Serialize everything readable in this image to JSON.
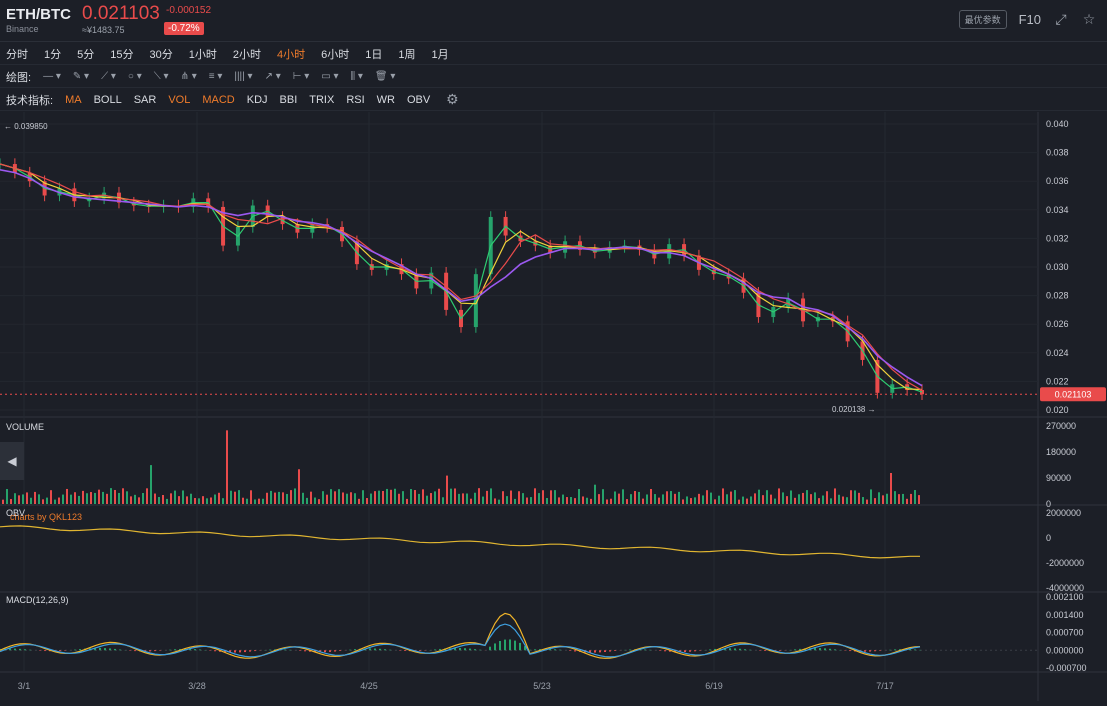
{
  "header": {
    "pair": "ETH/BTC",
    "exchange": "Binance",
    "price": "0.021103",
    "cny": "≈¥1483.75",
    "change": "-0.000152",
    "change_pct": "-0.72%",
    "param_button": "最优参数",
    "f10": "F10",
    "icons": [
      "fullscreen-icon",
      "star-icon"
    ]
  },
  "timeframes": [
    {
      "label": "分时",
      "active": false
    },
    {
      "label": "1分",
      "active": false
    },
    {
      "label": "5分",
      "active": false
    },
    {
      "label": "15分",
      "active": false
    },
    {
      "label": "30分",
      "active": false
    },
    {
      "label": "1小时",
      "active": false
    },
    {
      "label": "2小时",
      "active": false
    },
    {
      "label": "4小时",
      "active": true
    },
    {
      "label": "6小时",
      "active": false
    },
    {
      "label": "1日",
      "active": false
    },
    {
      "label": "1周",
      "active": false
    },
    {
      "label": "1月",
      "active": false
    }
  ],
  "drawing": {
    "label": "绘图:",
    "tools": [
      "—",
      "✎",
      "⟋",
      "○",
      "⟍",
      "⋔",
      "≡",
      "||||",
      "↗",
      "⊢",
      "▭",
      "⫼",
      "🗑"
    ]
  },
  "indicators_bar": {
    "label": "技术指标:",
    "items": [
      {
        "label": "MA",
        "active": true
      },
      {
        "label": "BOLL",
        "active": false
      },
      {
        "label": "SAR",
        "active": false
      },
      {
        "label": "VOL",
        "active": true
      },
      {
        "label": "MACD",
        "active": true
      },
      {
        "label": "KDJ",
        "active": false
      },
      {
        "label": "BBI",
        "active": false
      },
      {
        "label": "TRIX",
        "active": false
      },
      {
        "label": "RSI",
        "active": false
      },
      {
        "label": "WR",
        "active": false
      },
      {
        "label": "OBV",
        "active": false
      }
    ]
  },
  "watermark": "charts by QKL123",
  "colors": {
    "up": "#26a36b",
    "down": "#e94b4b",
    "ma_long": "#9b59f0",
    "ma_short": "#f0d23c",
    "ma_mid": "#e94b4b",
    "ma_fast": "#2ecc71",
    "obv": "#e0b531",
    "macd_dif": "#f0b429",
    "macd_dea": "#3fa0e0"
  },
  "chart_data": [
    {
      "type": "line",
      "title": "ETH/BTC",
      "x_ticks": [
        "3/1",
        "3/28",
        "4/25",
        "5/23",
        "6/19",
        "7/17"
      ],
      "ylim": [
        0.02,
        0.04
      ],
      "y_ticks": [
        "0.040",
        "0.038",
        "0.036",
        "0.034",
        "0.032",
        "0.030",
        "0.028",
        "0.026",
        "0.024",
        "0.022",
        "0.020"
      ],
      "max_annotation": "0.039850",
      "min_annotation": "0.020138",
      "last_price": "0.021103",
      "close_series": [
        0.0372,
        0.0366,
        0.036,
        0.035,
        0.0355,
        0.0346,
        0.0348,
        0.0352,
        0.0345,
        0.0343,
        0.0342,
        0.0343,
        0.0342,
        0.0348,
        0.0342,
        0.0315,
        0.0328,
        0.0343,
        0.0335,
        0.033,
        0.0324,
        0.033,
        0.0328,
        0.0318,
        0.0302,
        0.0298,
        0.0302,
        0.0295,
        0.0285,
        0.0296,
        0.027,
        0.0258,
        0.0295,
        0.0335,
        0.0322,
        0.0318,
        0.0315,
        0.031,
        0.0318,
        0.0312,
        0.031,
        0.0314,
        0.0315,
        0.0312,
        0.0306,
        0.0316,
        0.0308,
        0.0298,
        0.0295,
        0.0292,
        0.0282,
        0.0265,
        0.0272,
        0.0278,
        0.0262,
        0.0265,
        0.0262,
        0.0248,
        0.0235,
        0.0212,
        0.0218,
        0.0214,
        0.0211
      ],
      "ma_long_series": [
        0.0368,
        0.0366,
        0.0362,
        0.0356,
        0.0352,
        0.0349,
        0.0348,
        0.0347,
        0.0346,
        0.0345,
        0.0344,
        0.0343,
        0.0342,
        0.0343,
        0.0342,
        0.0338,
        0.0336,
        0.0338,
        0.0337,
        0.0335,
        0.0332,
        0.0331,
        0.0329,
        0.0324,
        0.0317,
        0.0311,
        0.0306,
        0.0301,
        0.0295,
        0.0292,
        0.0284,
        0.0276,
        0.0278,
        0.0286,
        0.0293,
        0.0302,
        0.0307,
        0.031,
        0.0313,
        0.0313,
        0.0312,
        0.0313,
        0.0314,
        0.0313,
        0.031,
        0.031,
        0.0308,
        0.0303,
        0.0299,
        0.0295,
        0.0289,
        0.0282,
        0.0279,
        0.0278,
        0.0272,
        0.027,
        0.0266,
        0.0258,
        0.025,
        0.0238,
        0.023,
        0.0223,
        0.0217
      ],
      "volume": {
        "ylim": [
          0,
          270000
        ],
        "y_ticks": [
          "270000",
          "180000",
          "90000",
          "0"
        ]
      },
      "obv": {
        "ylim": [
          -4000000,
          2000000
        ],
        "y_ticks": [
          "2000000",
          "0",
          "-2000000",
          "-4000000"
        ]
      },
      "macd": {
        "params": "MACD(12,26,9)",
        "ylim": [
          -0.0007,
          0.0021
        ],
        "y_ticks": [
          "0.002100",
          "0.001400",
          "0.000700",
          "0.000000",
          "-0.000700"
        ]
      }
    }
  ],
  "panels": {
    "volume_title": "VOLUME",
    "obv_title": "OBV",
    "macd_title": "MACD(12,26,9)"
  }
}
